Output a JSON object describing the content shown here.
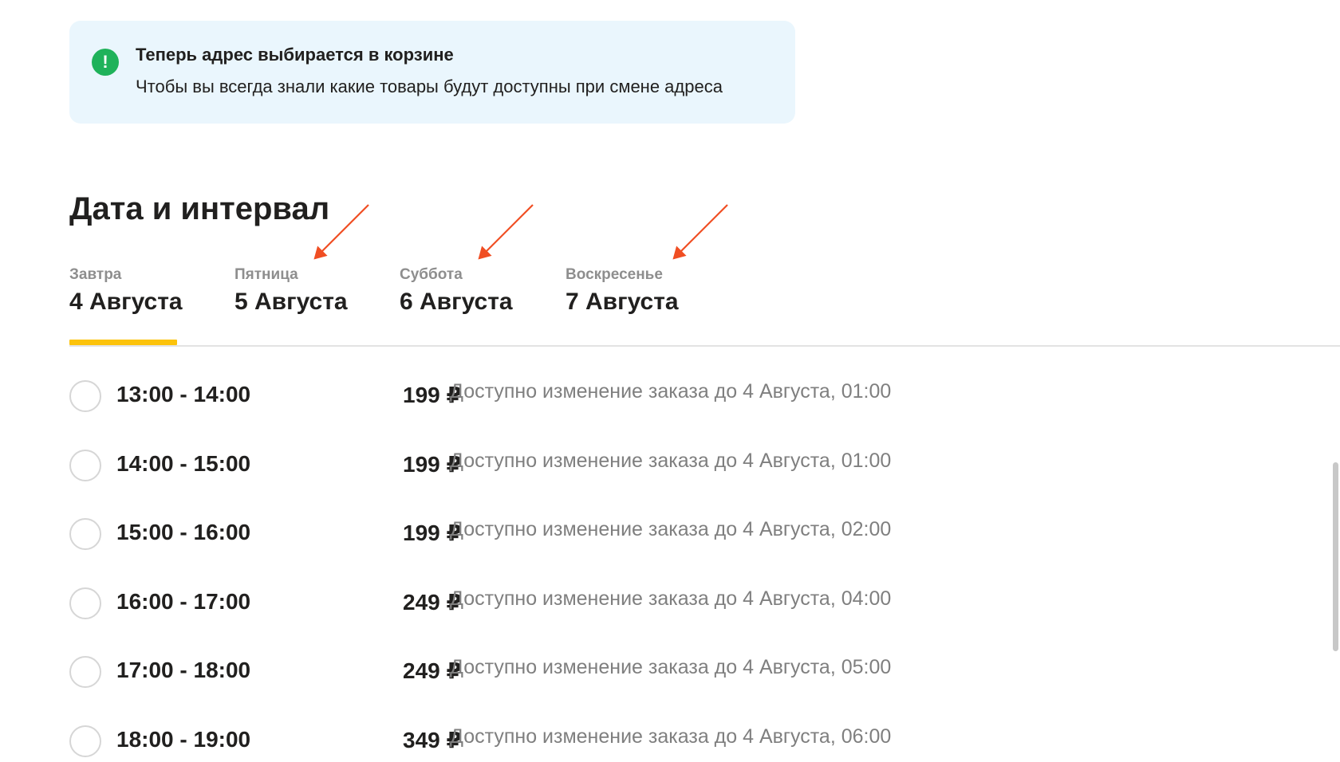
{
  "notice": {
    "icon": "exclamation-icon",
    "icon_glyph": "!",
    "title": "Теперь адрес выбирается в корзине",
    "text": "Чтобы вы всегда знали какие товары будут доступны при смене адреса"
  },
  "section": {
    "title": "Дата и интервал"
  },
  "tabs": [
    {
      "weekday": "Завтра",
      "date": "4 Августа",
      "selected": true
    },
    {
      "weekday": "Пятница",
      "date": "5 Августа",
      "selected": false
    },
    {
      "weekday": "Суббота",
      "date": "6 Августа",
      "selected": false
    },
    {
      "weekday": "Воскресенье",
      "date": "7 Августа",
      "selected": false
    }
  ],
  "slots": [
    {
      "time": "13:00 - 14:00",
      "price": "199 ₽",
      "note": "Доступно изменение заказа до 4 Августа, 01:00"
    },
    {
      "time": "14:00 - 15:00",
      "price": "199 ₽",
      "note": "Доступно изменение заказа до 4 Августа, 01:00"
    },
    {
      "time": "15:00 - 16:00",
      "price": "199 ₽",
      "note": "Доступно изменение заказа до 4 Августа, 02:00"
    },
    {
      "time": "16:00 - 17:00",
      "price": "249 ₽",
      "note": "Доступно изменение заказа до 4 Августа, 04:00"
    },
    {
      "time": "17:00 - 18:00",
      "price": "249 ₽",
      "note": "Доступно изменение заказа до 4 Августа, 05:00"
    },
    {
      "time": "18:00 - 19:00",
      "price": "349 ₽",
      "note": "Доступно изменение заказа до 4 Августа, 06:00"
    }
  ],
  "colors": {
    "notice_bg": "#eaf6fd",
    "notice_icon": "#1fb25a",
    "tab_underline": "#fcc30b",
    "annotation_arrow": "#f04e23",
    "muted_text": "#7f7f7f"
  }
}
